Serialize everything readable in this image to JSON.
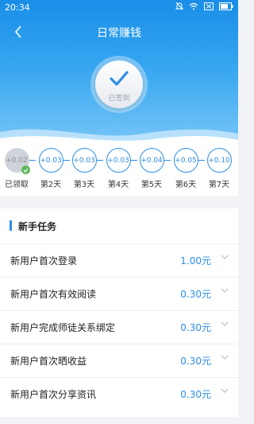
{
  "status": {
    "time": "20:34"
  },
  "nav": {
    "title": "日常赚钱"
  },
  "sign": {
    "label": "已签到"
  },
  "days": [
    {
      "amount": "+0.02",
      "label": "已领取",
      "done": true
    },
    {
      "amount": "+0.03",
      "label": "第2天",
      "done": false
    },
    {
      "amount": "+0.03",
      "label": "第3天",
      "done": false
    },
    {
      "amount": "+0.03",
      "label": "第4天",
      "done": false
    },
    {
      "amount": "+0.04",
      "label": "第5天",
      "done": false
    },
    {
      "amount": "+0.05",
      "label": "第6天",
      "done": false
    },
    {
      "amount": "+0.10",
      "label": "第7天",
      "done": false
    }
  ],
  "tasks": {
    "section_title": "新手任务",
    "items": [
      {
        "name": "新用户首次登录",
        "reward": "1.00元"
      },
      {
        "name": "新用户首次有效阅读",
        "reward": "0.30元"
      },
      {
        "name": "新用户完成师徒关系绑定",
        "reward": "0.30元"
      },
      {
        "name": "新用户首次晒收益",
        "reward": "0.30元"
      },
      {
        "name": "新用户首次分享资讯",
        "reward": "0.30元"
      }
    ]
  },
  "colors": {
    "accent": "#2d8ee6",
    "header_top": "#1a8ee8",
    "done": "#5cb85c"
  }
}
